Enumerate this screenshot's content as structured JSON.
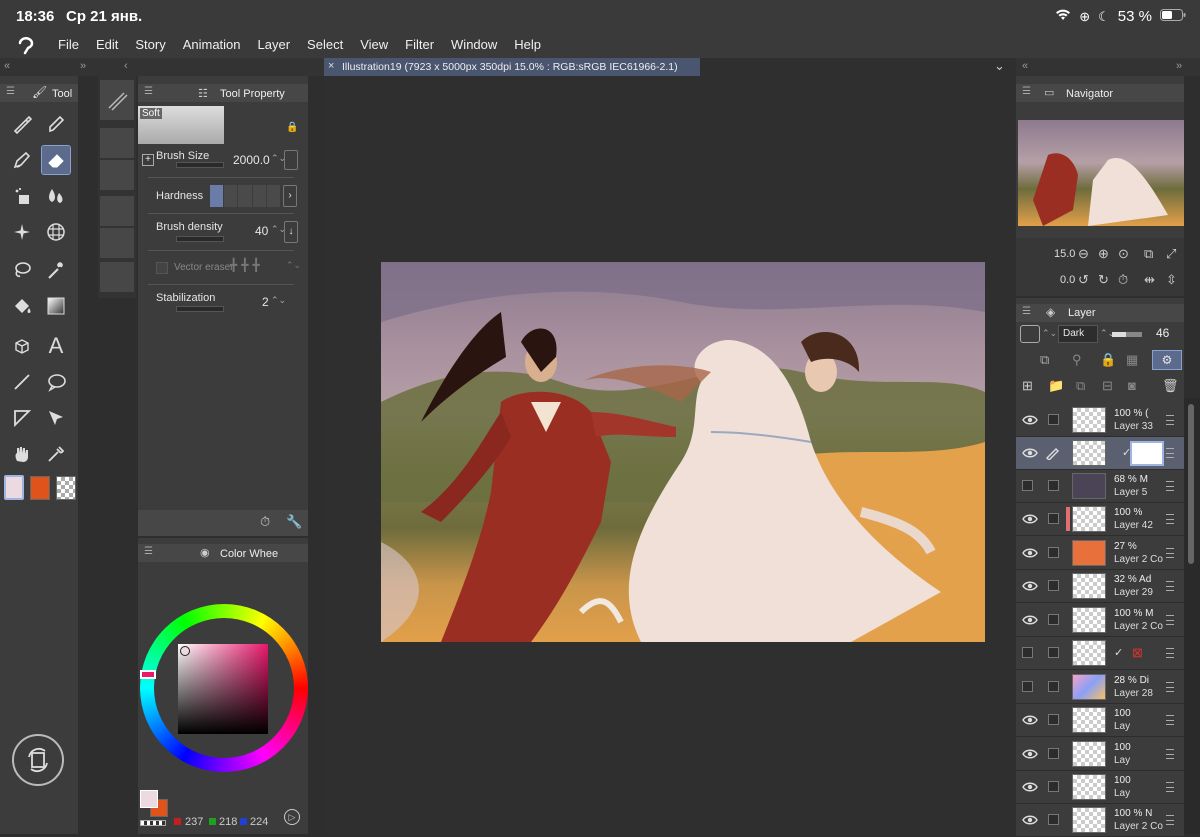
{
  "status": {
    "time": "18:36",
    "date": "Ср 21 янв.",
    "battery": "53 %"
  },
  "menu": [
    "File",
    "Edit",
    "Story",
    "Animation",
    "Layer",
    "Select",
    "View",
    "Filter",
    "Window",
    "Help"
  ],
  "tool_panel": {
    "title": "Tool"
  },
  "tool_property": {
    "title": "Tool Property",
    "brush_name": "Soft",
    "brush_size_label": "Brush Size",
    "brush_size_value": "2000.0",
    "hardness_label": "Hardness",
    "density_label": "Brush density",
    "density_value": "40",
    "vector_eraser_label": "Vector eraser",
    "stabilization_label": "Stabilization",
    "stabilization_value": "2"
  },
  "color_panel": {
    "title": "Color Whee",
    "r": "237",
    "g": "218",
    "b": "224",
    "main_color": "#edd9e0",
    "sub_color": "#e0541b"
  },
  "canvas_tab": {
    "title": "Illustration19 (7923 x 5000px 350dpi 15.0% : RGB:sRGB IEC61966-2.1)"
  },
  "navigator": {
    "title": "Navigator",
    "zoom": "15.0",
    "rotation": "0.0"
  },
  "layer_panel": {
    "title": "Layer",
    "blend_mode": "Dark",
    "opacity": "46",
    "rows": [
      {
        "pct": "100 % (",
        "name": "Layer 33",
        "visible": true
      },
      {
        "pct": "",
        "name": "",
        "visible": true
      },
      {
        "pct": "68 % M",
        "name": "Layer 5",
        "visible": false
      },
      {
        "pct": "100 %",
        "name": "Layer 42",
        "visible": true
      },
      {
        "pct": "27 %",
        "name": "Layer 2 Co",
        "visible": true
      },
      {
        "pct": "32 % Ad",
        "name": "Layer 29",
        "visible": true
      },
      {
        "pct": "100 % M",
        "name": "Layer 2 Co",
        "visible": true
      },
      {
        "pct": "",
        "name": "",
        "visible": false
      },
      {
        "pct": "28 % Di",
        "name": "Layer 28",
        "visible": false
      },
      {
        "pct": "100",
        "name": "Lay",
        "visible": true
      },
      {
        "pct": "100",
        "name": "Lay",
        "visible": true
      },
      {
        "pct": "100",
        "name": "Lay",
        "visible": true
      },
      {
        "pct": "100 % N",
        "name": "Layer 2 Co",
        "visible": true
      }
    ]
  }
}
